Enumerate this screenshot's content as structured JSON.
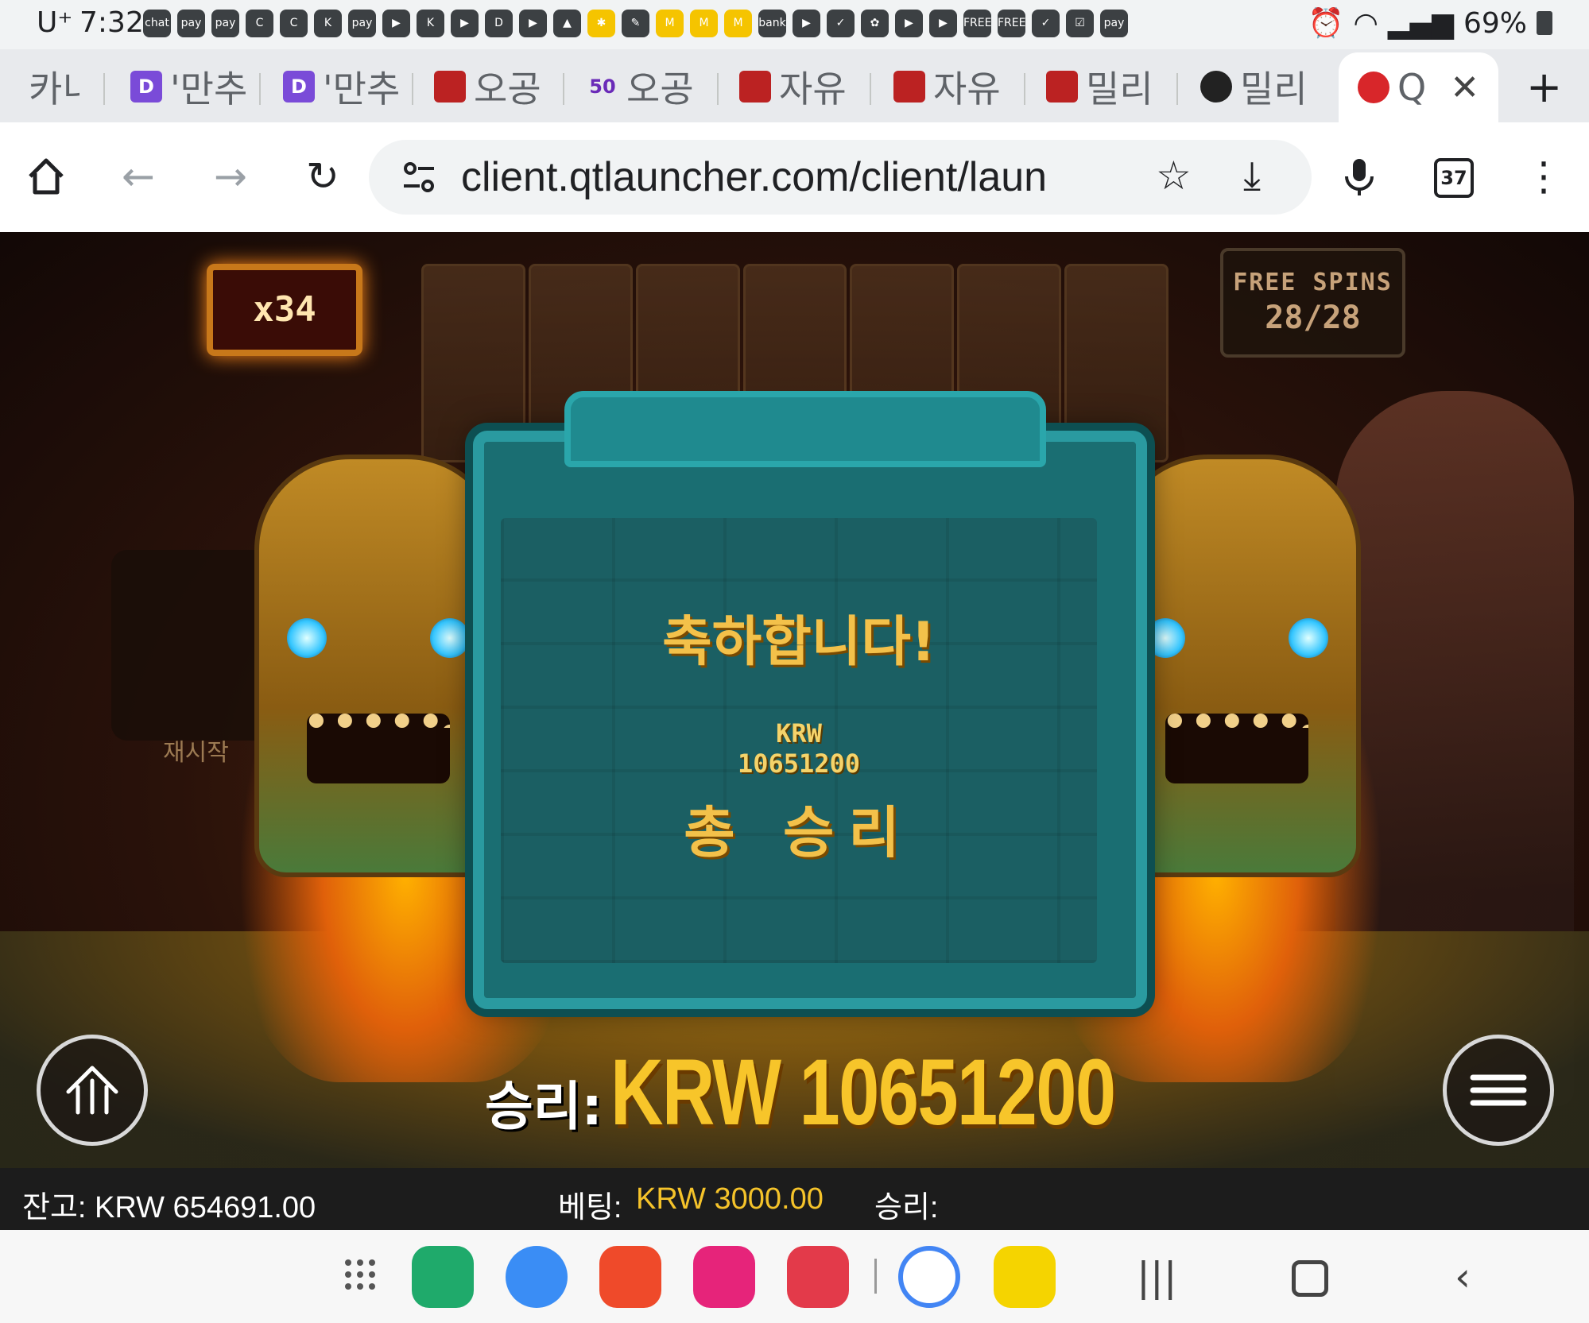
{
  "status_bar": {
    "carrier": "U⁺",
    "time": "7:32",
    "battery": "69%",
    "notifications": [
      "chat",
      "pay",
      "pay",
      "C",
      "C",
      "K",
      "pay",
      "▶",
      "K",
      "▶",
      "D",
      "▶",
      "▲",
      "✱",
      "✎",
      "M",
      "M",
      "M",
      "bank",
      "▶",
      "✓",
      "✿",
      "▶",
      "▶",
      "FREE",
      "FREE",
      "✓",
      "☑",
      "pay"
    ]
  },
  "browser": {
    "tabs": [
      {
        "label": "카니",
        "favicon": ""
      },
      {
        "label": "'만추",
        "favicon": "D"
      },
      {
        "label": "'만추",
        "favicon": "D"
      },
      {
        "label": "오공",
        "favicon": "slot"
      },
      {
        "label": "오공",
        "favicon": "50"
      },
      {
        "label": "자유",
        "favicon": "slot"
      },
      {
        "label": "자유",
        "favicon": "slot"
      },
      {
        "label": "밀리",
        "favicon": "slot"
      },
      {
        "label": "밀리",
        "favicon": "crown"
      },
      {
        "label": "Q",
        "favicon": "paw",
        "active": true
      }
    ],
    "url": "client.qtlauncher.com/client/laun",
    "tab_count": "37",
    "icons": [
      "home-icon",
      "back-icon",
      "forward-icon",
      "reload-icon",
      "site-settings-icon",
      "star-icon",
      "download-icon",
      "mic-icon",
      "tabs-icon",
      "more-icon"
    ]
  },
  "game": {
    "multiplier": "x34",
    "free_spins": {
      "title": "FREE SPINS",
      "count": "28/28"
    },
    "restart_label": "재시작",
    "popup": {
      "title": "축하합니다!",
      "currency": "KRW",
      "amount": "10651200",
      "subtitle": "총 승리"
    },
    "win_banner": {
      "label": "승리:",
      "value": "KRW 10651200"
    },
    "info": {
      "balance": "잔고: KRW 654691.00",
      "bet_label": "베팅:",
      "bet_value": "KRW 3000.00",
      "win_label": "승리:"
    }
  },
  "colors": {
    "gold": "#f7c52a",
    "teal": "#1b5f63",
    "bet_value": "#f5c32a"
  },
  "dock": {
    "apps": [
      "phone-app-icon",
      "messages-app-icon",
      "notes-app-icon",
      "gallery-app-icon",
      "camera-app-icon",
      "google-app-icon",
      "shortcut-app-icon"
    ]
  }
}
